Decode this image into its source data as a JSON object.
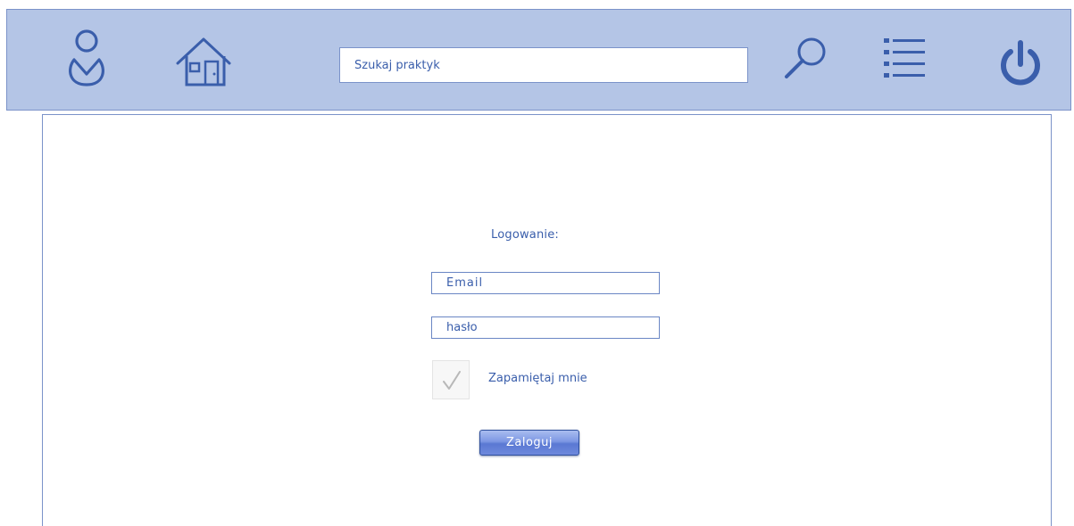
{
  "header": {
    "search": {
      "placeholder": "Szukaj praktyk",
      "value": ""
    },
    "icons": {
      "profile": "user-icon",
      "home": "home-icon",
      "search": "search-icon",
      "menu": "list-icon",
      "logout": "power-icon"
    }
  },
  "login": {
    "title": "Logowanie:",
    "email_placeholder": "Email",
    "password_placeholder": "hasło",
    "remember_label": "Zapamiętaj mnie",
    "remember_checked": true,
    "submit_label": "Zaloguj"
  },
  "colors": {
    "toolbar_bg": "#b4c5e6",
    "accent": "#3a5eab",
    "border": "#7b93c9"
  }
}
